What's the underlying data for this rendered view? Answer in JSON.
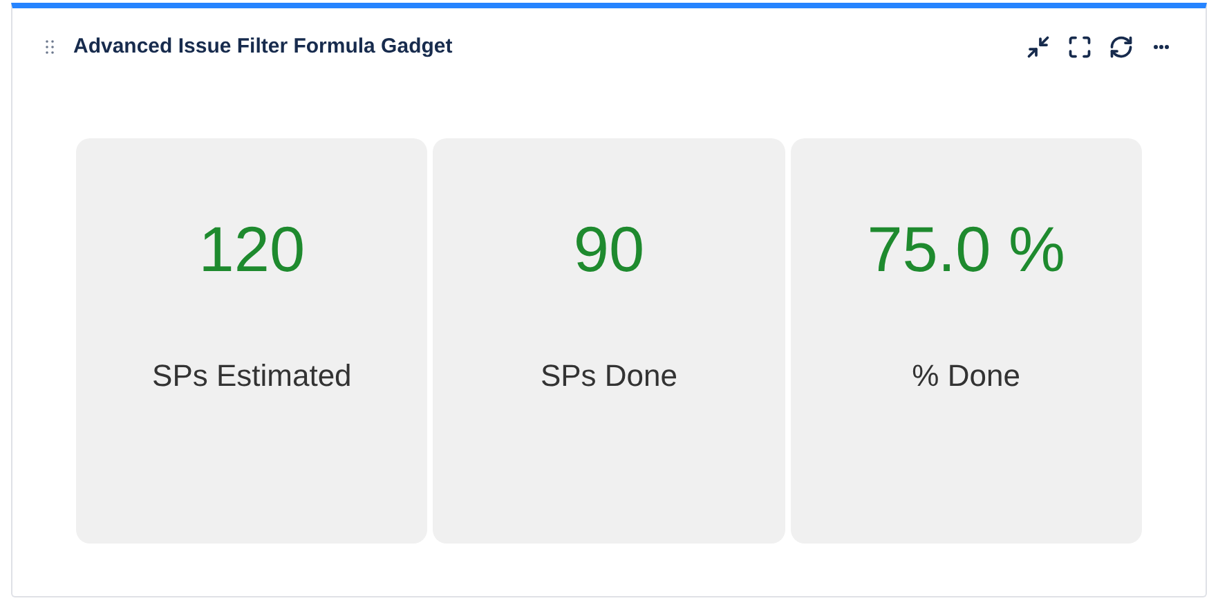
{
  "gadget": {
    "title": "Advanced Issue Filter Formula Gadget"
  },
  "metrics": [
    {
      "value": "120",
      "label": "SPs Estimated"
    },
    {
      "value": "90",
      "label": "SPs Done"
    },
    {
      "value": "75.0 %",
      "label": "% Done"
    }
  ]
}
